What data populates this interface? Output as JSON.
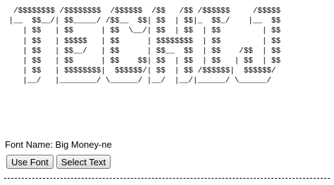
{
  "ascii_art": {
    "lines": [
      "  /$$$$$$$$ /$$$$$$$$  /$$$$$$  /$$   /$$ /$$$$$$     /$$$$$",
      " |__  $$__/| $$_____/ /$$__  $$| $$  | $$|_  $$_/    |__  $$",
      "    | $$   | $$      | $$  \\__/| $$  | $$  | $$         | $$",
      "    | $$   | $$$$$   | $$      | $$$$$$$$  | $$         | $$",
      "    | $$   | $$__/   | $$      | $$__  $$  | $$    /$$  | $$",
      "    | $$   | $$      | $$    $$| $$  | $$  | $$   | $$  | $$",
      "    | $$   | $$$$$$$$|  $$$$$$/| $$  | $$ /$$$$$$|  $$$$$$/",
      "    |__/   |________/ \\______/ |__/  |__/|______/ \\______/"
    ]
  },
  "font_name_label": "Font Name: Big Money-ne",
  "buttons": {
    "use_font": "Use Font",
    "select_text": "Select Text"
  }
}
